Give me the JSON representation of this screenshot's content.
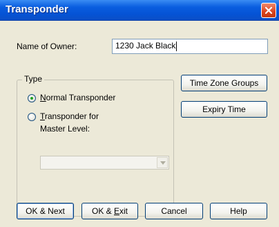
{
  "window": {
    "title": "Transponder"
  },
  "owner": {
    "label": "Name of Owner:",
    "value": "1230 Jack Black"
  },
  "type_group": {
    "legend": "Type",
    "normal": {
      "pre": "",
      "accel": "N",
      "post": "ormal Transponder",
      "selected": true
    },
    "master": {
      "pre": "",
      "accel": "T",
      "post": "ransponder for",
      "line2": "Master Level:",
      "selected": false
    },
    "master_level_select": {
      "value": ""
    }
  },
  "side_buttons": {
    "time_zone_groups": "Time Zone Groups",
    "expiry_time": "Expiry Time"
  },
  "buttons": {
    "ok_next": "OK & Next",
    "ok_exit": {
      "pre": "OK & ",
      "accel": "E",
      "post": "xit"
    },
    "cancel": "Cancel",
    "help": "Help"
  },
  "colors": {
    "title_bar": "#0553d5",
    "close_button": "#d9431e",
    "dialog_bg": "#ece9d8"
  }
}
